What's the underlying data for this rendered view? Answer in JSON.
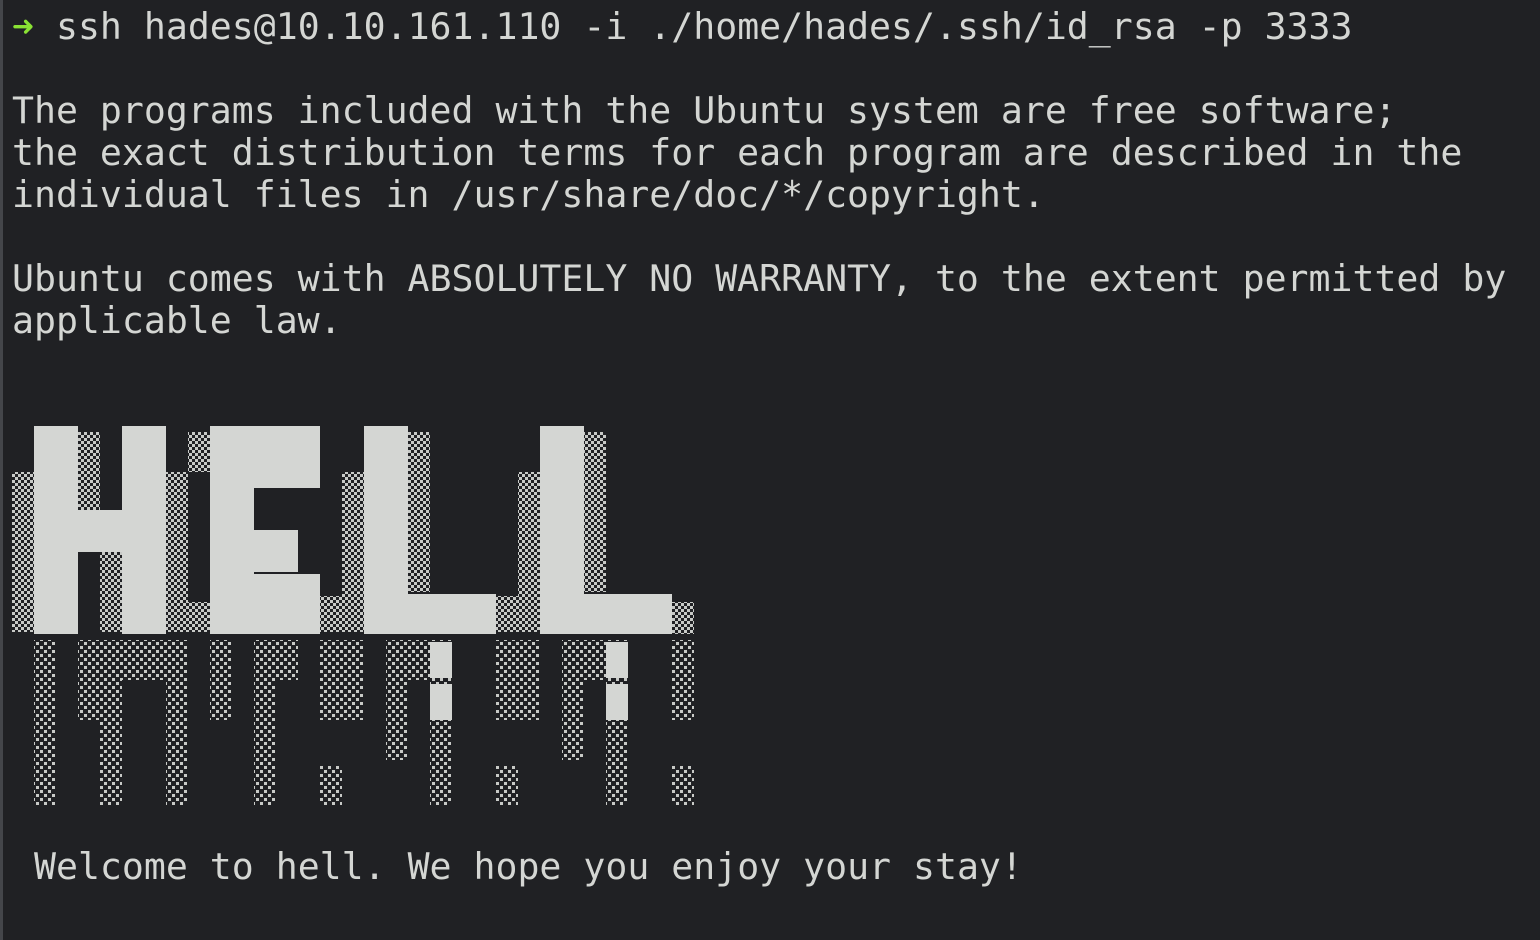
{
  "terminal": {
    "background": "#202124",
    "foreground": "#d4d6d3",
    "prompt_color": "#8ae234",
    "prompt": {
      "arrow": "➜",
      "command": "ssh hades@10.10.161.110 -i ./home/hades/.ssh/id_rsa -p 3333"
    },
    "lines": [
      "The programs included with the Ubuntu system are free software;",
      "the exact distribution terms for each program are described in the",
      "individual files in /usr/share/doc/*/copyright.",
      "Ubuntu comes with ABSOLUTELY NO WARRANTY, to the extent permitted by",
      "applicable law."
    ],
    "banner": {
      "text": "HELL",
      "style": "ascii-art-dripping"
    },
    "welcome": "Welcome to hell. We hope you enjoy your stay!"
  }
}
